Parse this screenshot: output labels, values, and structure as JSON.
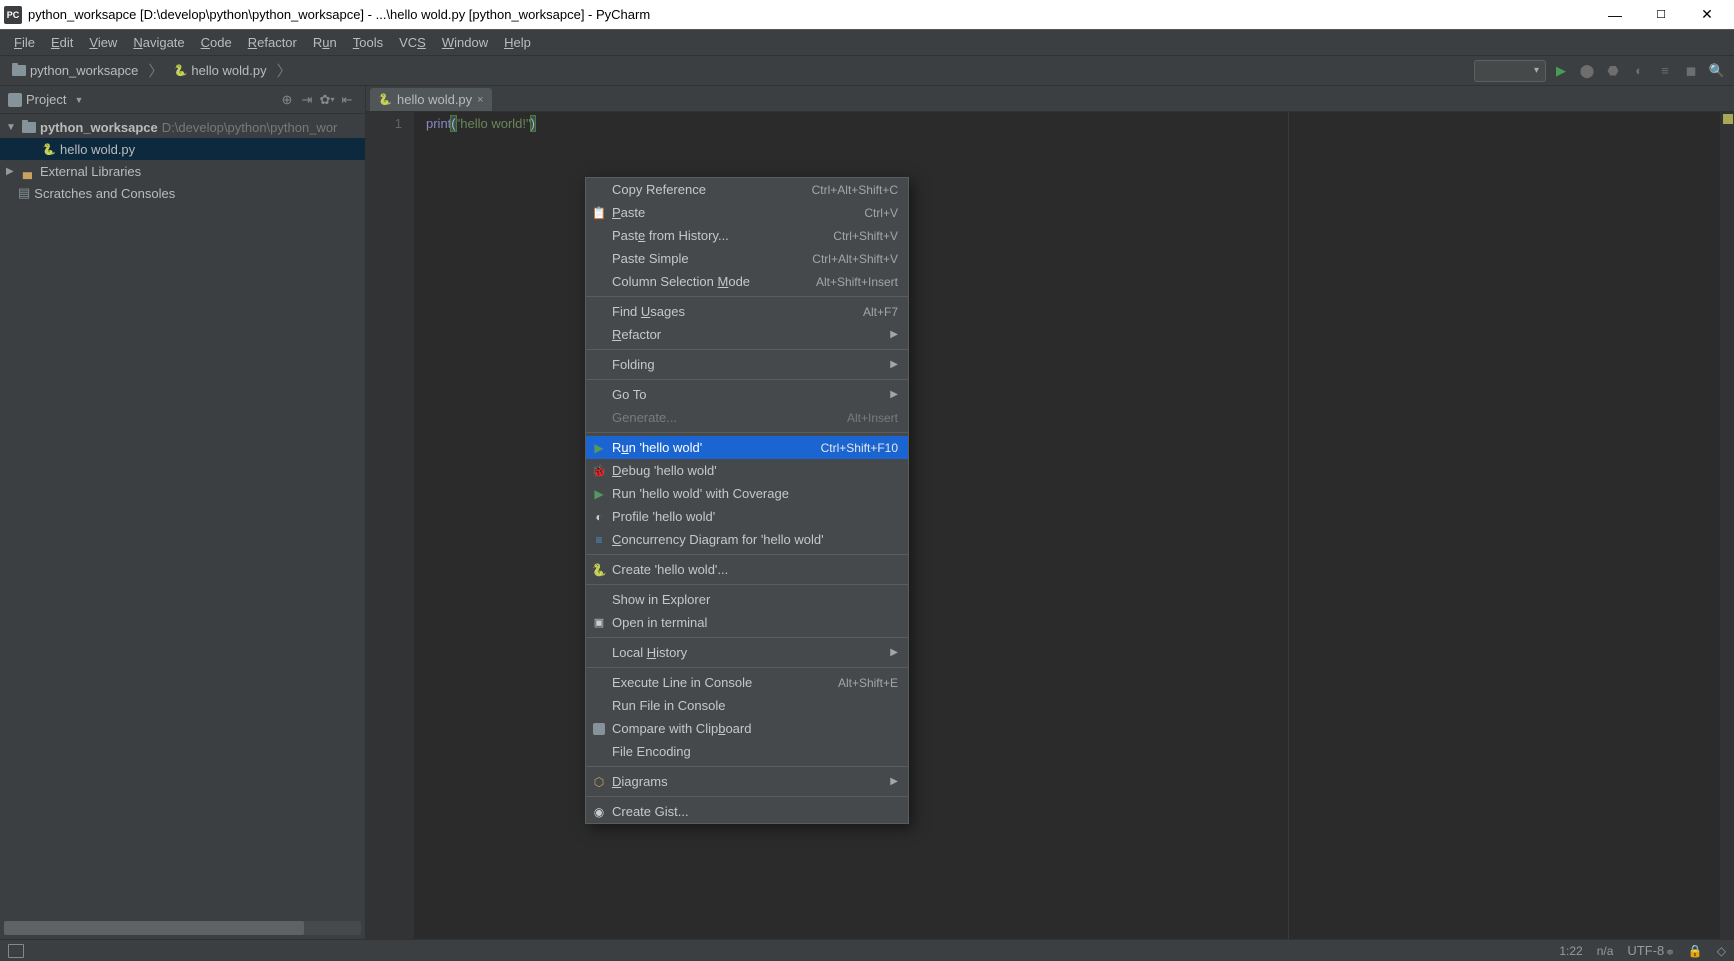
{
  "window": {
    "title": "python_worksapce [D:\\develop\\python\\python_worksapce] - ...\\hello wold.py [python_worksapce] - PyCharm"
  },
  "menubar": {
    "file": "File",
    "edit": "Edit",
    "view": "View",
    "navigate": "Navigate",
    "code": "Code",
    "refactor": "Refactor",
    "run": "Run",
    "tools": "Tools",
    "vcs": "VCS",
    "window": "Window",
    "help": "Help"
  },
  "breadcrumb": {
    "root": "python_worksapce",
    "file": "hello wold.py"
  },
  "projectPanel": {
    "title": "Project",
    "root": {
      "name": "python_worksapce",
      "path": "D:\\develop\\python\\python_wor"
    },
    "file": "hello wold.py",
    "extLib": "External Libraries",
    "scratches": "Scratches and Consoles"
  },
  "editor": {
    "tab": "hello wold.py",
    "lineNum": "1",
    "code": {
      "fn": "print",
      "open": "(",
      "str": "\"hello world!\"",
      "close": ")"
    }
  },
  "context": {
    "copyRef": {
      "label": "Copy Reference",
      "sc": "Ctrl+Alt+Shift+C"
    },
    "paste": {
      "label": "Paste",
      "sc": "Ctrl+V"
    },
    "pasteHist": {
      "label": "Paste from History...",
      "sc": "Ctrl+Shift+V"
    },
    "pasteSimple": {
      "label": "Paste Simple",
      "sc": "Ctrl+Alt+Shift+V"
    },
    "colSel": {
      "label": "Column Selection Mode",
      "sc": "Alt+Shift+Insert"
    },
    "findUsages": {
      "label": "Find Usages",
      "sc": "Alt+F7"
    },
    "refactor": {
      "label": "Refactor"
    },
    "folding": {
      "label": "Folding"
    },
    "goto": {
      "label": "Go To"
    },
    "generate": {
      "label": "Generate...",
      "sc": "Alt+Insert"
    },
    "run": {
      "label": "Run 'hello wold'",
      "sc": "Ctrl+Shift+F10"
    },
    "debug": {
      "label": "Debug 'hello wold'"
    },
    "coverage": {
      "label": "Run 'hello wold' with Coverage"
    },
    "profile": {
      "label": "Profile 'hello wold'"
    },
    "concurrency": {
      "label": "Concurrency Diagram for 'hello wold'"
    },
    "create": {
      "label": "Create 'hello wold'..."
    },
    "explorer": {
      "label": "Show in Explorer"
    },
    "terminal": {
      "label": "Open in terminal"
    },
    "localHist": {
      "label": "Local History"
    },
    "execLine": {
      "label": "Execute Line in Console",
      "sc": "Alt+Shift+E"
    },
    "runFile": {
      "label": "Run File in Console"
    },
    "compare": {
      "label": "Compare with Clipboard"
    },
    "encoding": {
      "label": "File Encoding"
    },
    "diagrams": {
      "label": "Diagrams"
    },
    "gist": {
      "label": "Create Gist..."
    }
  },
  "statusbar": {
    "pos": "1:22",
    "insp": "n/a",
    "enc": "UTF-8"
  }
}
